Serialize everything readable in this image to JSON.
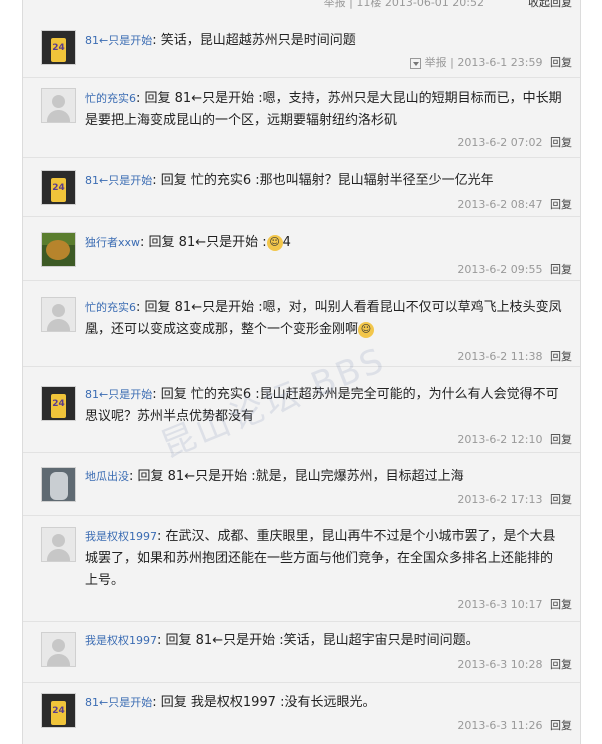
{
  "top": {
    "meta": "举报 | 11楼 2013-06-01 20:52",
    "link": "收起回复"
  },
  "watermark": "昆山论坛 BBS",
  "replies": [
    {
      "user": "81←只是开始",
      "text": "笑话，昆山超越苏州只是时间问题",
      "report": "举报",
      "time": "2013-6-1 23:59",
      "reply": "回复",
      "avatar": "jersey"
    },
    {
      "user": "忙的充实6",
      "text": "回复 81←只是开始 :嗯，支持，苏州只是大昆山的短期目标而已，中长期是要把上海变成昆山的一个区，远期要辐射纽约洛杉矶",
      "time": "2013-6-2 07:02",
      "reply": "回复",
      "avatar": "blank"
    },
    {
      "user": "81←只是开始",
      "text": "回复 忙的充实6 :那也叫辐射？昆山辐射半径至少一亿光年",
      "time": "2013-6-2 08:47",
      "reply": "回复",
      "avatar": "jersey"
    },
    {
      "user": "独行者xxw",
      "text": "回复 81←只是开始 :",
      "tail": "4",
      "time": "2013-6-2 09:55",
      "reply": "回复",
      "avatar": "forest"
    },
    {
      "user": "忙的充实6",
      "text": "回复 81←只是开始 :嗯，对，叫别人看看昆山不仅可以草鸡飞上枝头变凤凰，还可以变成这变成那，整个一个变形金刚啊",
      "time": "2013-6-2 11:38",
      "reply": "回复",
      "avatar": "blank"
    },
    {
      "user": "81←只是开始",
      "text": "回复 忙的充实6 :昆山赶超苏州是完全可能的，为什么有人会觉得不可思议呢？苏州半点优势都没有",
      "time": "2013-6-2 12:10",
      "reply": "回复",
      "avatar": "jersey"
    },
    {
      "user": "地瓜出没",
      "text": "回复 81←只是开始 :就是，昆山完爆苏州，目标超过上海",
      "time": "2013-6-2 17:13",
      "reply": "回复",
      "avatar": "dim"
    },
    {
      "user": "我是权权1997",
      "text": "在武汉、成都、重庆眼里，昆山再牛不过是个小城市罢了，是个大县城罢了，如果和苏州抱团还能在一些方面与他们竞争，在全国众多排名上还能排的上号。",
      "time": "2013-6-3 10:17",
      "reply": "回复",
      "avatar": "blank"
    },
    {
      "user": "我是权权1997",
      "text": "回复 81←只是开始 :笑话，昆山超宇宙只是时间问题。",
      "time": "2013-6-3 10:28",
      "reply": "回复",
      "avatar": "blank"
    },
    {
      "user": "81←只是开始",
      "text": "回复 我是权权1997 :没有长远眼光。",
      "time": "2013-6-3 11:26",
      "reply": "回复",
      "avatar": "jersey"
    }
  ]
}
